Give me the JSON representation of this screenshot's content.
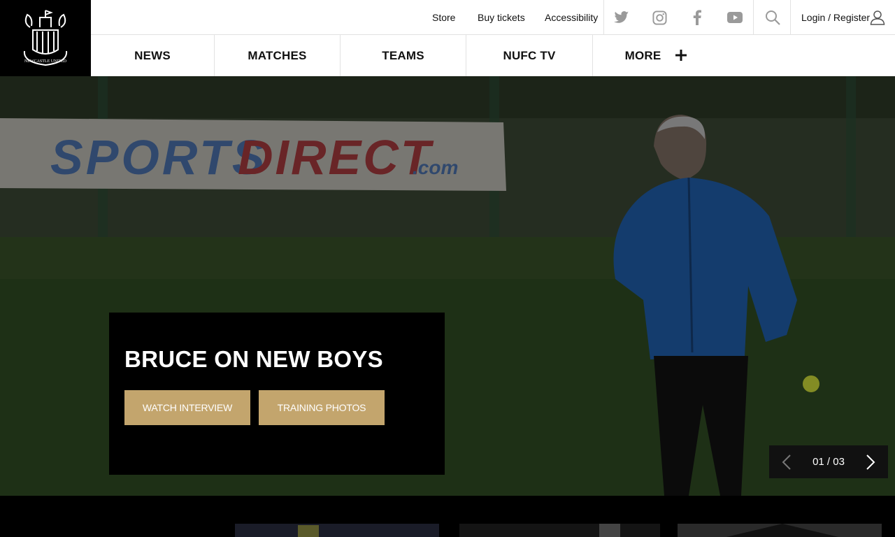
{
  "brand": {
    "logo_text": "NEWCASTLE UNITED"
  },
  "utility": {
    "links": [
      "Store",
      "Buy tickets",
      "Accessibility"
    ],
    "social": [
      "twitter-icon",
      "instagram-icon",
      "facebook-icon",
      "youtube-icon"
    ],
    "login_label": "Login / Register"
  },
  "nav": {
    "items": [
      "NEWS",
      "MATCHES",
      "TEAMS",
      "NUFC TV"
    ],
    "more_label": "MORE"
  },
  "hero": {
    "title": "BRUCE ON NEW BOYS",
    "buttons": [
      "WATCH INTERVIEW",
      "TRAINING PHOTOS"
    ],
    "background_sign": "SPORTS DIRECT.com",
    "pager": {
      "current": "01",
      "total": "03",
      "label": "01 / 03"
    }
  },
  "colors": {
    "gold": "#c3a56d",
    "black": "#000000",
    "white": "#ffffff"
  }
}
